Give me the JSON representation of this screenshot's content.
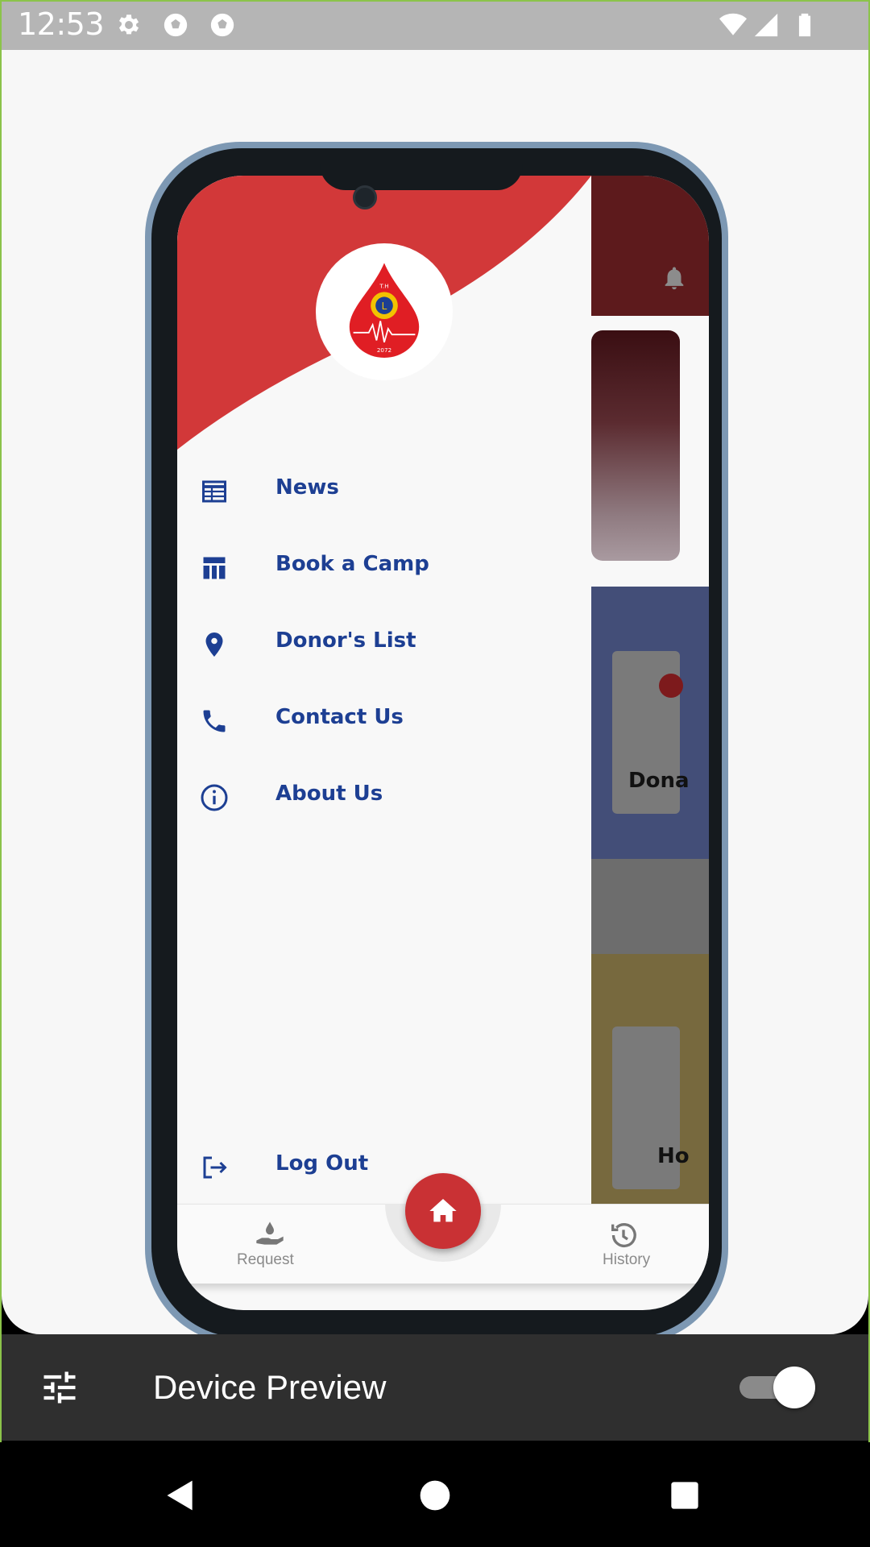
{
  "status_bar": {
    "time": "12:53",
    "icons": [
      "settings-icon",
      "soccer-ball-icon",
      "soccer-ball-icon",
      "wifi-icon",
      "signal-icon",
      "battery-icon"
    ]
  },
  "app": {
    "drawer": {
      "logo": {
        "top_text": "T.H",
        "bottom_text": "2072",
        "icon": "blood-drop-lions-logo"
      },
      "items": [
        {
          "label": "News",
          "icon": "newspaper-icon"
        },
        {
          "label": "Book a Camp",
          "icon": "table-icon"
        },
        {
          "label": "Donor's List",
          "icon": "location-pin-icon"
        },
        {
          "label": "Contact Us",
          "icon": "phone-icon"
        },
        {
          "label": "About Us",
          "icon": "info-icon"
        }
      ],
      "logout": {
        "label": "Log Out",
        "icon": "logout-icon"
      }
    },
    "background": {
      "card2_text": "Dona",
      "card3_text": "Ho",
      "bell_icon": "bell-icon"
    },
    "bottom_nav": {
      "left": {
        "label": "Request",
        "icon": "donate-drop-icon"
      },
      "center": {
        "icon": "home-icon"
      },
      "right": {
        "label": "History",
        "icon": "history-icon"
      }
    }
  },
  "device_preview": {
    "title": "Device Preview",
    "toggle_on": true,
    "settings_icon": "tune-icon"
  },
  "colors": {
    "accent_red": "#C93134",
    "drawer_text": "#1D3F93",
    "frame_green": "#8BC34A"
  }
}
